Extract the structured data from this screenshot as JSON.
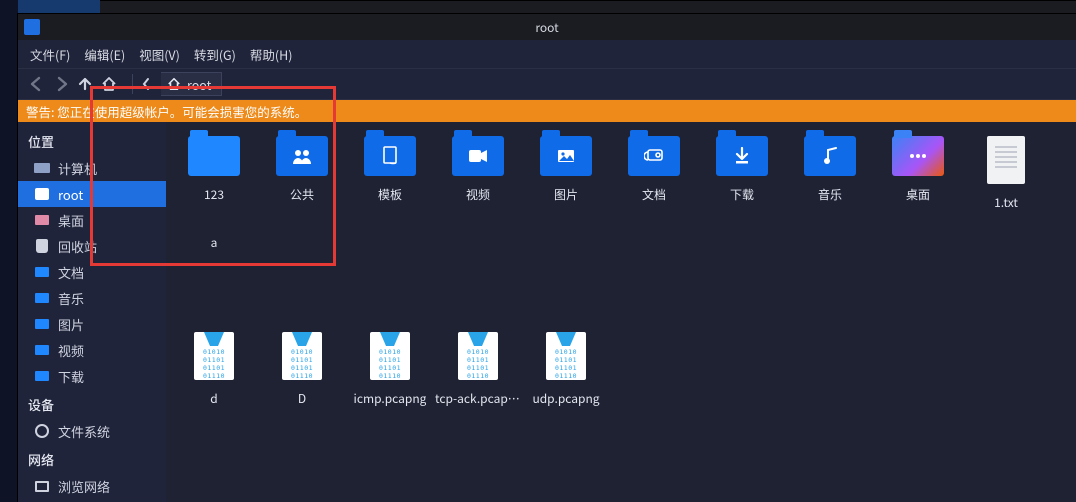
{
  "window": {
    "title": "root"
  },
  "menu": {
    "file": "文件(F)",
    "edit": "编辑(E)",
    "view": "视图(V)",
    "go": "转到(G)",
    "help": "帮助(H)"
  },
  "path": {
    "segment": "root"
  },
  "warning": {
    "text": "警告: 您正在使用超级帐户。可能会损害您的系统。"
  },
  "sidebar": {
    "places_head": "位置",
    "devices_head": "设备",
    "network_head": "网络",
    "places": [
      {
        "label": "计算机",
        "kind": "computer"
      },
      {
        "label": "root",
        "kind": "drive",
        "active": true
      },
      {
        "label": "桌面",
        "kind": "folder-pink"
      },
      {
        "label": "回收站",
        "kind": "trash"
      },
      {
        "label": "文档",
        "kind": "folder-blue"
      },
      {
        "label": "音乐",
        "kind": "folder-blue"
      },
      {
        "label": "图片",
        "kind": "folder-blue"
      },
      {
        "label": "视频",
        "kind": "folder-blue"
      },
      {
        "label": "下载",
        "kind": "folder-blue"
      }
    ],
    "devices": [
      {
        "label": "文件系统",
        "kind": "disk"
      }
    ],
    "network": [
      {
        "label": "浏览网络",
        "kind": "netmon"
      }
    ]
  },
  "files": {
    "row1": [
      {
        "label": "123",
        "type": "folder-plain"
      },
      {
        "label": "公共",
        "type": "folder-public"
      },
      {
        "label": "模板",
        "type": "folder-templates"
      },
      {
        "label": "视频",
        "type": "folder-videos"
      },
      {
        "label": "图片",
        "type": "folder-pictures"
      },
      {
        "label": "文档",
        "type": "folder-documents"
      },
      {
        "label": "下载",
        "type": "folder-downloads"
      },
      {
        "label": "音乐",
        "type": "folder-music"
      },
      {
        "label": "桌面",
        "type": "folder-desktop"
      },
      {
        "label": "1.txt",
        "type": "txt"
      },
      {
        "label": "a",
        "type": "cut"
      }
    ],
    "row2": [
      {
        "label": "d",
        "type": "pcap"
      },
      {
        "label": "D",
        "type": "pcap"
      },
      {
        "label": "icmp.pcapng",
        "type": "pcap"
      },
      {
        "label": "tcp-ack.pcapng",
        "type": "pcap"
      },
      {
        "label": "udp.pcapng",
        "type": "pcap"
      }
    ]
  },
  "pcap_bits": "01010\n01101\n01101\n01110",
  "colors": {
    "accent": "#1f6fe0",
    "warn": "#ed8a19",
    "annotation": "#e53935"
  }
}
